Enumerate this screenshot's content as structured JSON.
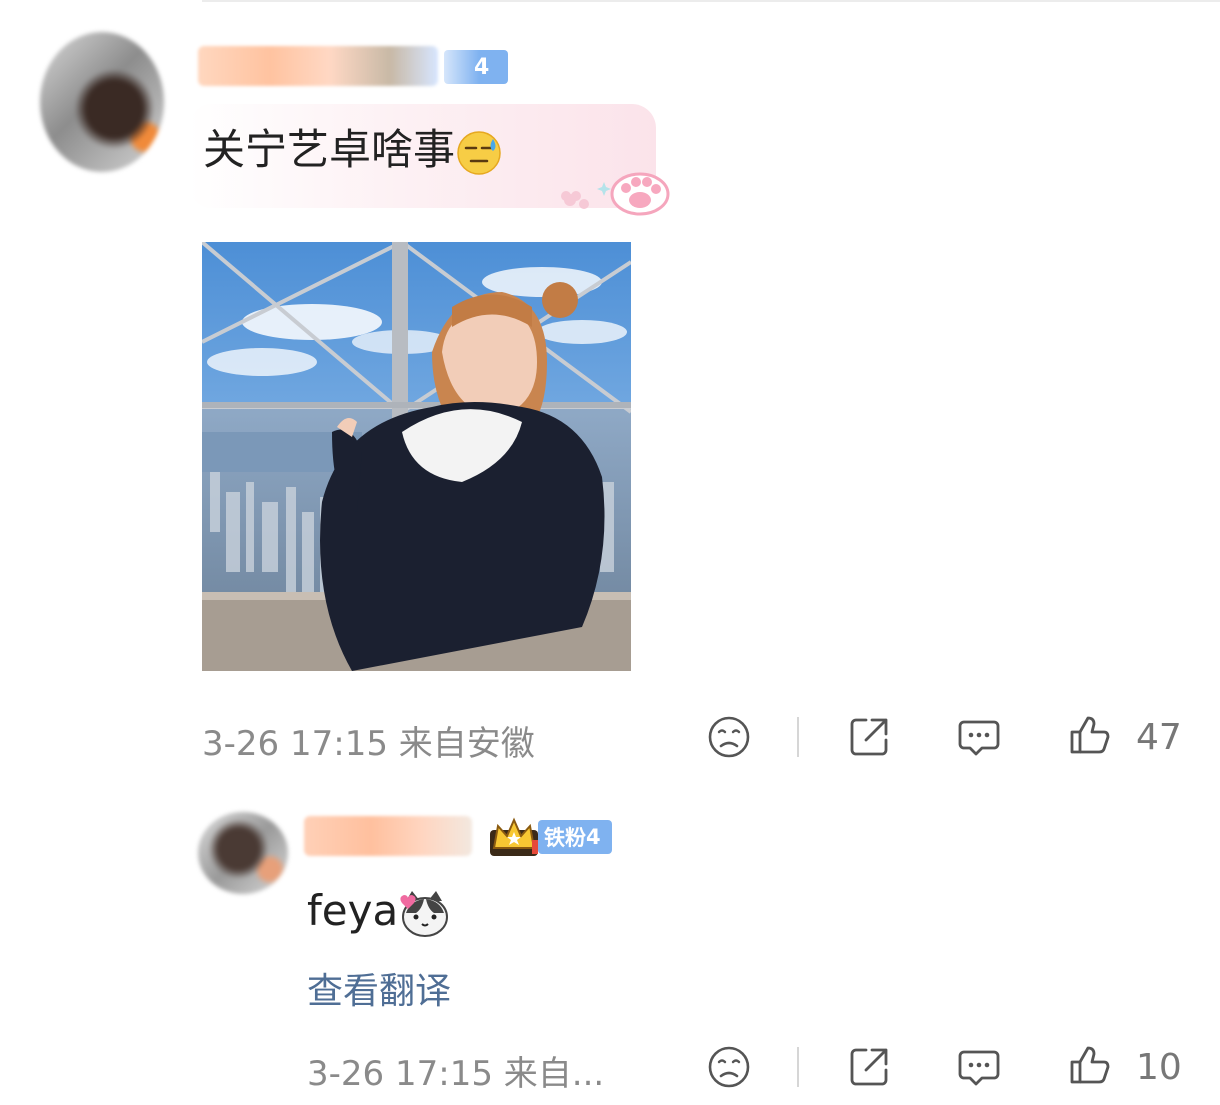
{
  "comment": {
    "badge_level": "4",
    "text": "关宁艺卓啥事",
    "text_emoji": "sweat-smile-emoji",
    "meta": "3-26 17:15 来自安徽",
    "like_count": "47"
  },
  "reply": {
    "badge_label": "铁粉",
    "badge_level": "4",
    "text": "feya",
    "text_emoji": "cat-heart-emoji",
    "translate_label": "查看翻译",
    "meta": "3-26 17:15 来自...",
    "like_count": "10"
  },
  "icons": [
    "dislike-face-icon",
    "share-icon",
    "comment-icon",
    "like-thumb-icon",
    "crown-icon",
    "paw-sticker-icon"
  ]
}
